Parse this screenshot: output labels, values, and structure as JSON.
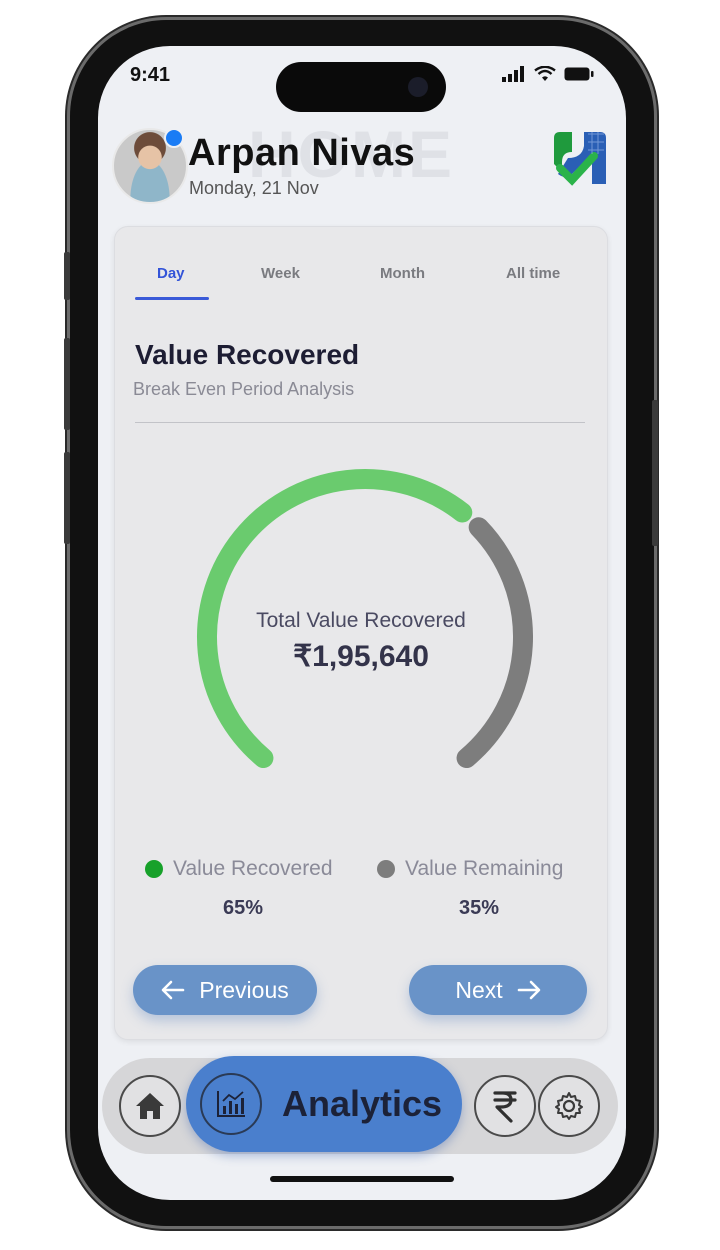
{
  "status_bar": {
    "time": "9:41"
  },
  "header": {
    "ghost_text": "HOME",
    "user_name": "Arpan Nivas",
    "date": "Monday, 21 Nov"
  },
  "tabs": [
    {
      "label": "Day",
      "active": true
    },
    {
      "label": "Week",
      "active": false
    },
    {
      "label": "Month",
      "active": false
    },
    {
      "label": "All time",
      "active": false
    }
  ],
  "card": {
    "title": "Value Recovered",
    "subtitle": "Break Even Period Analysis"
  },
  "chart_data": {
    "type": "pie",
    "center_label": "Total Value Recovered",
    "center_value": "₹1,95,640",
    "series": [
      {
        "name": "Value Recovered",
        "value": 65,
        "color": "#6acb6e"
      },
      {
        "name": "Value Remaining",
        "value": 35,
        "color": "#7d7d7d"
      }
    ]
  },
  "legend": {
    "recovered_label": "Value Recovered",
    "recovered_pct": "65%",
    "recovered_color": "#17a12a",
    "remaining_label": "Value Remaining",
    "remaining_pct": "35%",
    "remaining_color": "#7d7d7d"
  },
  "buttons": {
    "previous": "Previous",
    "next": "Next"
  },
  "bottom_nav": {
    "active_label": "Analytics",
    "items": [
      "home-icon",
      "analytics-icon",
      "rupee-icon",
      "settings-icon"
    ]
  },
  "colors": {
    "accent": "#3354d8",
    "button": "#6993c8",
    "nav_active": "#4a7fcd"
  }
}
